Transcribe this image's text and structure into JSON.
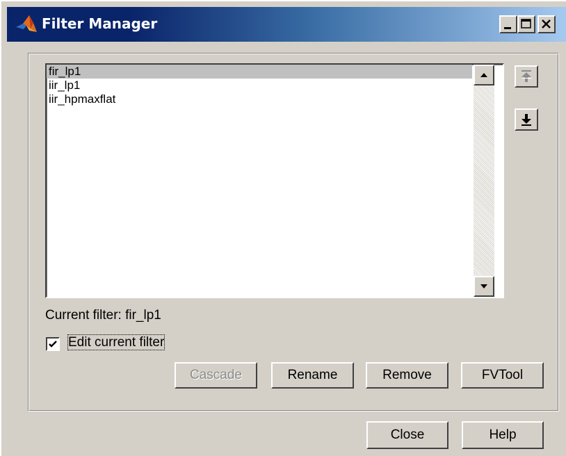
{
  "window": {
    "title": "Filter Manager",
    "icon": "matlab-icon",
    "controls": [
      "minimize-icon",
      "maximize-icon",
      "close-icon"
    ]
  },
  "filter_list": {
    "items": [
      "fir_lp1",
      "iir_lp1",
      "iir_hpmaxflat"
    ],
    "selected": "fir_lp1"
  },
  "side_buttons": {
    "move_up_icon": "move-to-top-icon",
    "move_up_enabled": false,
    "move_down_icon": "move-to-bottom-icon",
    "move_down_enabled": true
  },
  "current_filter_label": "Current filter: fir_lp1",
  "edit_current": {
    "label": "Edit current filter",
    "checked": true
  },
  "actions": {
    "cascade": "Cascade",
    "cascade_enabled": false,
    "rename": "Rename",
    "remove": "Remove",
    "fvtool": "FVTool"
  },
  "footer": {
    "close": "Close",
    "help": "Help"
  },
  "colors": {
    "title_gradient_start": "#0a246a",
    "title_gradient_end": "#a6caf0",
    "dialog_face": "#d4d0c8",
    "selected_row": "#c0c0c0"
  }
}
